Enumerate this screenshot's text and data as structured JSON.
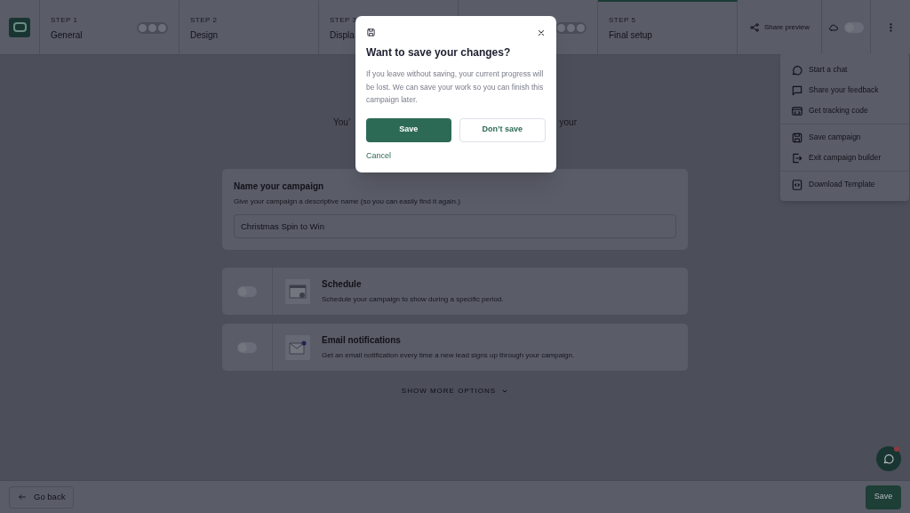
{
  "steps": [
    {
      "step": "STEP 1",
      "label": "General",
      "selected": false,
      "indicator": true
    },
    {
      "step": "STEP 2",
      "label": "Design",
      "selected": false,
      "indicator": false
    },
    {
      "step": "STEP 3",
      "label": "Displa",
      "selected": false,
      "indicator": false
    },
    {
      "selected": false,
      "indicator": true
    },
    {
      "step": "STEP 5",
      "label": "Final setup",
      "selected": true,
      "indicator": false
    }
  ],
  "share_button": "Share preview",
  "autosave": {
    "on": false
  },
  "menu": {
    "groups": [
      [
        "Start a chat",
        "Share your feedback",
        "Get tracking code"
      ],
      [
        "Save campaign",
        "Exit campaign builder"
      ],
      [
        "Download Template"
      ]
    ]
  },
  "intro_fragments": [
    "You’",
    "your"
  ],
  "name_card": {
    "title": "Name your campaign",
    "hint": "Give your campaign a descriptive name (so you can easily find it again.)",
    "value": "Christmas Spin to Win"
  },
  "options": [
    {
      "kind": "schedule",
      "title": "Schedule",
      "description": "Schedule your campaign to show during a specific period.",
      "on": false
    },
    {
      "kind": "email",
      "title": "Email notifications",
      "description": "Get an email notification every time a new lead signs up through your campaign.",
      "on": false
    }
  ],
  "show_more": "SHOW MORE OPTIONS",
  "footer": {
    "back": "Go back",
    "save": "Save"
  },
  "chat_unread": true,
  "dialog": {
    "title": "Want to save your changes?",
    "body": "If you leave without saving, your current progress will be lost. We can save your work so you can finish this campaign later.",
    "primary": "Save",
    "secondary": "Don’t save",
    "cancel": "Cancel"
  }
}
